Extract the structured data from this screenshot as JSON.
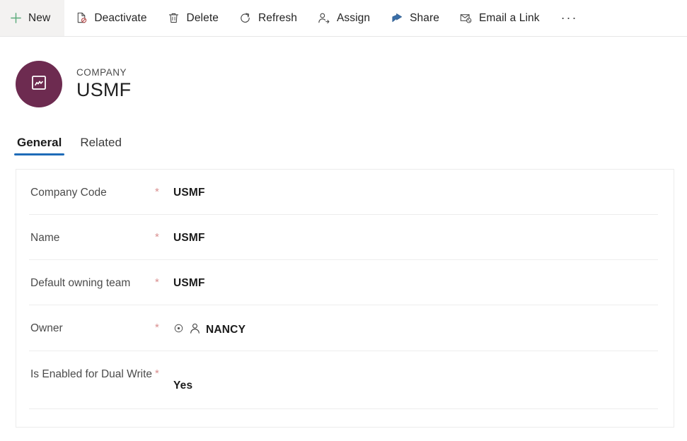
{
  "commandbar": {
    "buttons": [
      {
        "label": "New",
        "icon": "plus-icon"
      },
      {
        "label": "Deactivate",
        "icon": "deactivate-icon"
      },
      {
        "label": "Delete",
        "icon": "trash-icon"
      },
      {
        "label": "Refresh",
        "icon": "refresh-icon"
      },
      {
        "label": "Assign",
        "icon": "assign-person-icon"
      },
      {
        "label": "Share",
        "icon": "share-icon"
      },
      {
        "label": "Email a Link",
        "icon": "email-link-icon"
      }
    ],
    "overflow_label": "···"
  },
  "header": {
    "entity_type": "COMPANY",
    "record_title": "USMF",
    "avatar_icon": "company-icon",
    "avatar_color": "#6d2b50"
  },
  "tabs": [
    {
      "label": "General",
      "selected": true
    },
    {
      "label": "Related",
      "selected": false
    }
  ],
  "tab_accent_color": "#1e6bb8",
  "form": {
    "required_marker": "*",
    "fields": [
      {
        "label": "Company Code",
        "value": "USMF",
        "required": true,
        "tall": false
      },
      {
        "label": "Name",
        "value": "USMF",
        "required": true,
        "tall": false
      },
      {
        "label": "Default owning team",
        "value": "USMF",
        "required": true,
        "tall": false
      },
      {
        "label": "Owner",
        "value": "NANCY",
        "required": true,
        "tall": false
      },
      {
        "label": "Is Enabled for Dual Write",
        "value": "Yes",
        "required": true,
        "tall": true
      }
    ]
  }
}
